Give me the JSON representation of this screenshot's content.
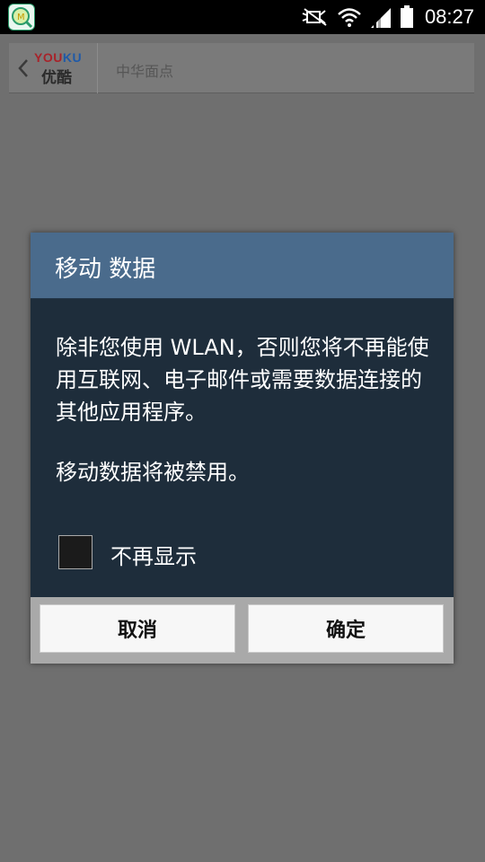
{
  "status_bar": {
    "time": "08:27",
    "icons": [
      "app-notification-icon",
      "mute-icon",
      "wifi-icon",
      "signal-icon",
      "battery-icon"
    ]
  },
  "app_bar": {
    "logo_en_1": "YOU",
    "logo_en_2": "KU",
    "logo_cn": "优酷",
    "title": "中华面点"
  },
  "dialog": {
    "title": "移动 数据",
    "message": "除非您使用 WLAN，否则您将不再能使用互联网、电子邮件或需要数据连接的其他应用程序。",
    "note": "移动数据将被禁用。",
    "checkbox_label": "不再显示",
    "checkbox_checked": false,
    "cancel_label": "取消",
    "ok_label": "确定"
  },
  "colors": {
    "dialog_header": "#4a6b8c",
    "dialog_body": "#1e2d3b",
    "dim_background": "#6f6f6f"
  }
}
